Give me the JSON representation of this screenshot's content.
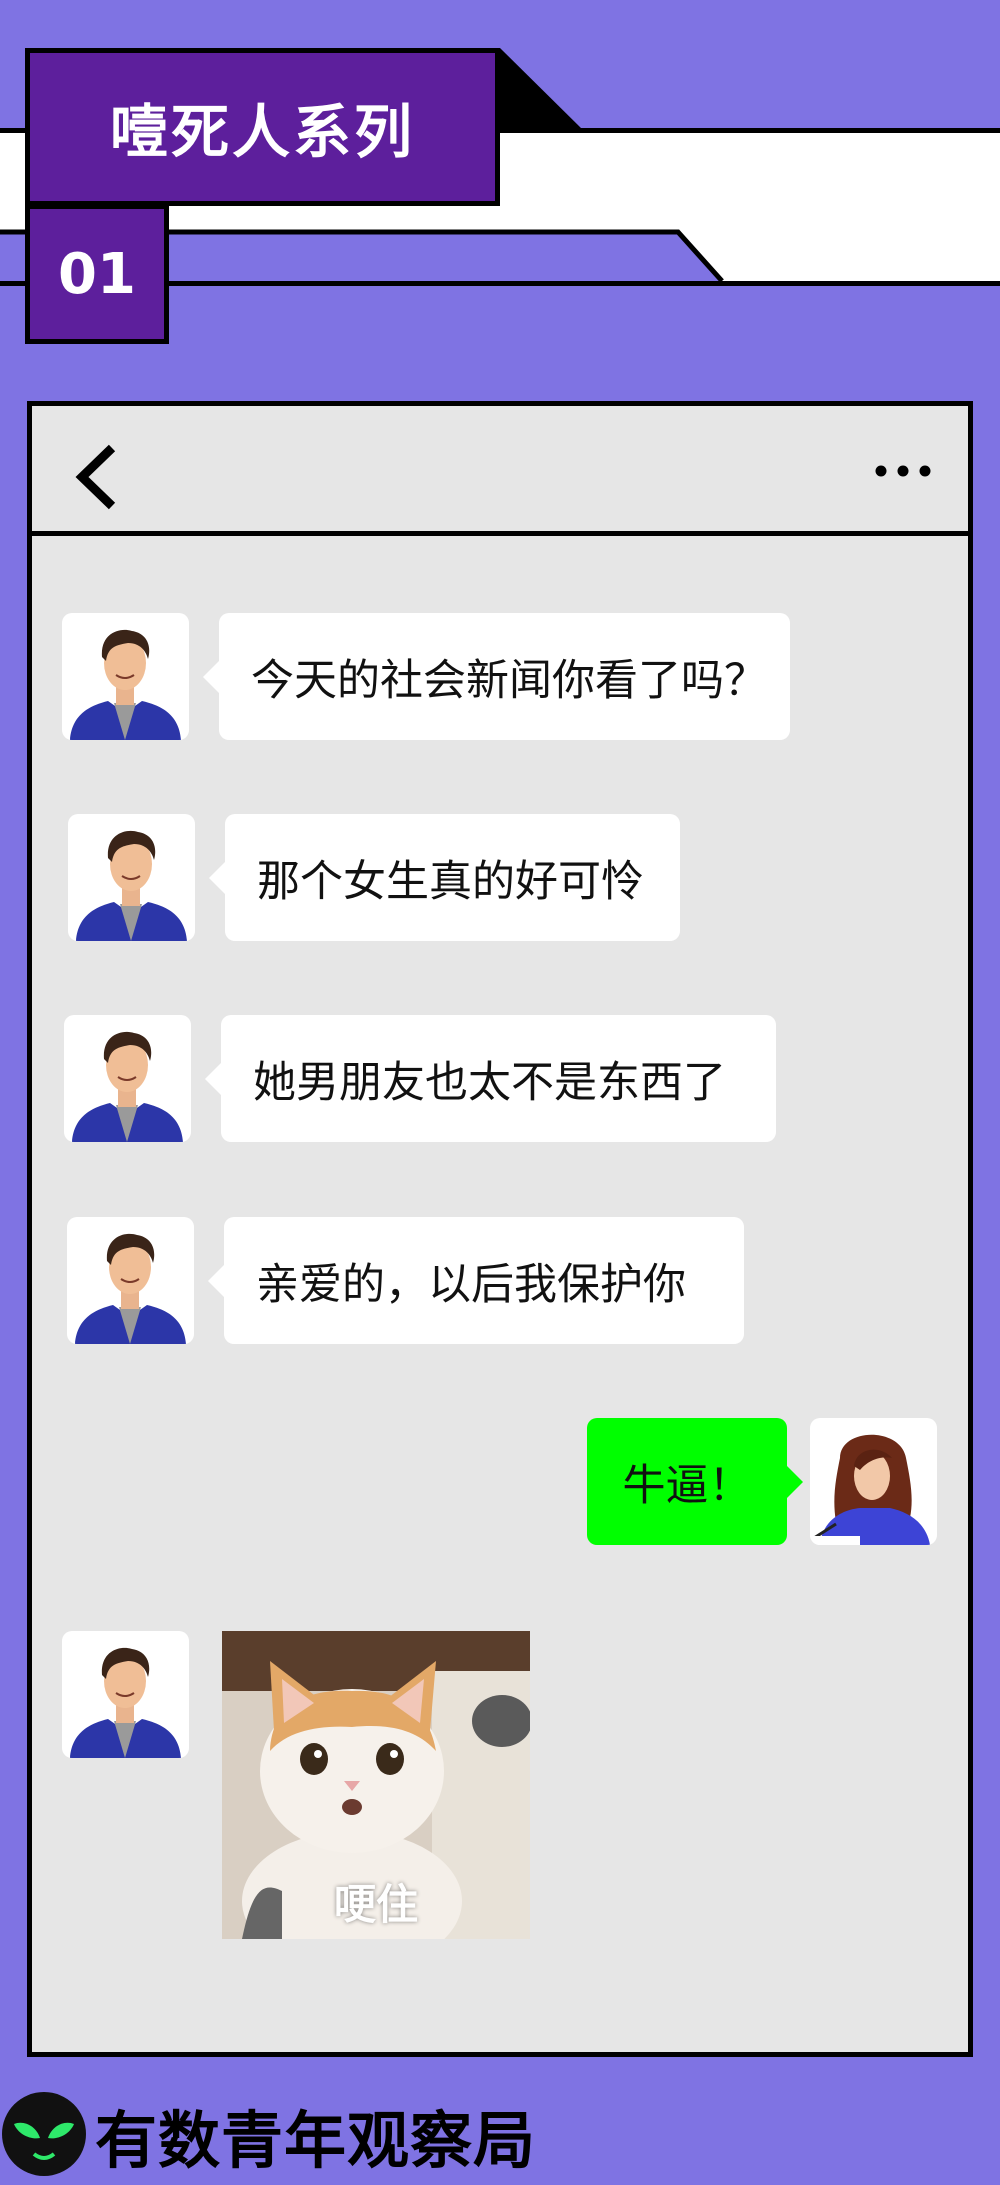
{
  "header": {
    "title": "噎死人系列",
    "number": "01"
  },
  "chat": {
    "back_icon": "chevron-left-icon",
    "more_icon": "more-dots-icon",
    "messages": [
      {
        "side": "left",
        "sender": "boyfriend",
        "text": "今天的社会新闻你看了吗？"
      },
      {
        "side": "left",
        "sender": "boyfriend",
        "text": "那个女生真的好可怜"
      },
      {
        "side": "left",
        "sender": "boyfriend",
        "text": "她男朋友也太不是东西了"
      },
      {
        "side": "left",
        "sender": "boyfriend",
        "text": "亲爱的，以后我保护你"
      },
      {
        "side": "right",
        "sender": "girlfriend",
        "text": "牛逼！"
      },
      {
        "side": "left",
        "sender": "boyfriend",
        "type": "sticker",
        "caption": "哽住"
      }
    ]
  },
  "footer": {
    "brand": "有数青年观察局",
    "logo_icon": "alien-head-logo"
  },
  "colors": {
    "background": "#7F73E3",
    "title_box": "#5D1F9C",
    "chat_bg": "#E6E6E6",
    "my_bubble": "#00FF00"
  }
}
